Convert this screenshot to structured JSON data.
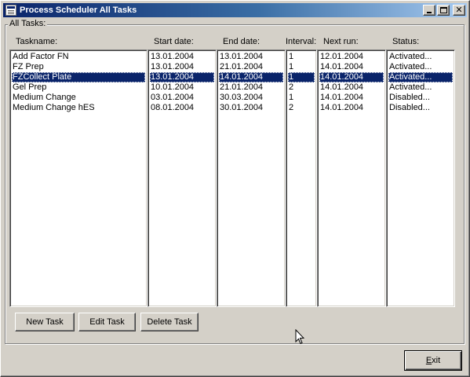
{
  "window": {
    "title": "Process Scheduler All Tasks",
    "icon": "app-icon"
  },
  "titlebar_buttons": {
    "minimize": "minimize-icon",
    "maximize": "maximize-icon",
    "close": "close-icon"
  },
  "group": {
    "label": "All Tasks:"
  },
  "columns": {
    "taskname": "Taskname:",
    "start_date": "Start date:",
    "end_date": "End date:",
    "interval": "Interval:",
    "next_run": "Next run:",
    "status": "Status:"
  },
  "tasks": [
    {
      "taskname": "Add Factor FN",
      "start_date": "13.01.2004",
      "end_date": "13.01.2004",
      "interval": "1",
      "next_run": "12.01.2004",
      "status": "Activated..."
    },
    {
      "taskname": "FZ Prep",
      "start_date": "13.01.2004",
      "end_date": "21.01.2004",
      "interval": "1",
      "next_run": "14.01.2004",
      "status": "Activated..."
    },
    {
      "taskname": "FZCollect Plate",
      "start_date": "13.01.2004",
      "end_date": "14.01.2004",
      "interval": "1",
      "next_run": "14.01.2004",
      "status": "Activated..."
    },
    {
      "taskname": "Gel Prep",
      "start_date": "10.01.2004",
      "end_date": "21.01.2004",
      "interval": "2",
      "next_run": "14.01.2004",
      "status": "Activated..."
    },
    {
      "taskname": "Medium Change",
      "start_date": "03.01.2004",
      "end_date": "30.03.2004",
      "interval": "1",
      "next_run": "14.01.2004",
      "status": "Disabled..."
    },
    {
      "taskname": "Medium Change hES",
      "start_date": "08.01.2004",
      "end_date": "30.01.2004",
      "interval": "2",
      "next_run": "14.01.2004",
      "status": "Disabled..."
    }
  ],
  "selected_row": 2,
  "buttons": {
    "new_task": "New Task",
    "edit_task": "Edit Task",
    "delete_task": "Delete Task",
    "exit_accel": "E",
    "exit_rest": "xit"
  },
  "colors": {
    "selection": "#0a246a",
    "face": "#d4d0c8",
    "titlebar_start": "#0a246a",
    "titlebar_end": "#a6caf0"
  }
}
